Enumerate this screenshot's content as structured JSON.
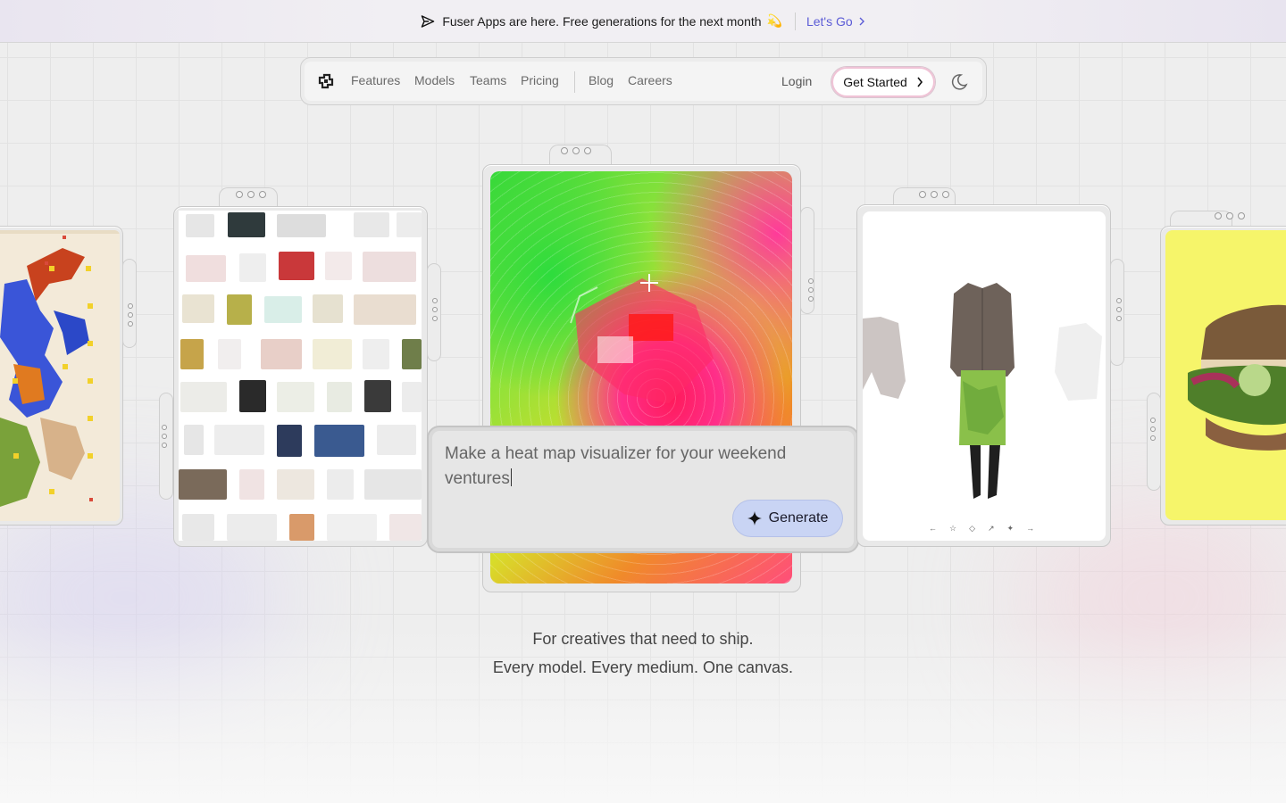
{
  "banner": {
    "message": "Fuser Apps are here. Free generations for the next month",
    "emoji": "💫",
    "cta": "Let's Go"
  },
  "nav": {
    "links": [
      "Features",
      "Models",
      "Teams",
      "Pricing"
    ],
    "secondary_links": [
      "Blog",
      "Careers"
    ],
    "login": "Login",
    "get_started": "Get Started"
  },
  "prompt": {
    "value": "Make a heat map visualizer for your weekend ventures",
    "generate_label": "Generate"
  },
  "tagline": {
    "line1": "For creatives that need to ship.",
    "line2": "Every model. Every medium. One canvas."
  },
  "colors": {
    "accent": "#5b5bd6",
    "generate_bg": "#c9d4f4",
    "sandwich_bg": "#f6f56a"
  },
  "icons": [
    "send-icon",
    "logo-icon",
    "chevron-right-icon",
    "moon-icon",
    "sparkle-icon",
    "crosshair-icon"
  ]
}
